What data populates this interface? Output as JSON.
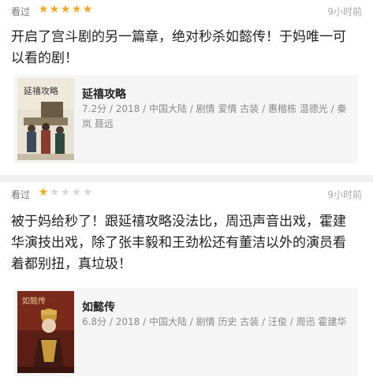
{
  "reviews": [
    {
      "status": "看过",
      "rating": 5,
      "time": "9小时前",
      "text": "开启了宫斗剧的另一篇章，绝对秒杀如懿传！于妈唯一可以看的剧！",
      "movie": {
        "title": "延禧攻略",
        "info": "7.2分 / 2018 / 中国大陆 / 剧情 爱情 古装 / 惠楷栋 温德光 / 秦岚 聂远",
        "poster_label": "延禧攻略"
      }
    },
    {
      "status": "看过",
      "rating": 1,
      "time": "9小时前",
      "text": "被于妈给秒了！跟延禧攻略没法比，周迅声音出戏，霍建华演技出戏，除了张丰毅和王劲松还有董洁以外的演员看着都别扭，真垃圾！",
      "movie": {
        "title": "如懿传",
        "info": "6.8分 / 2018 / 中国大陆 / 剧情 历史 古装 / 汪俊 / 周迅 霍建华",
        "poster_label": "如懿传"
      }
    }
  ],
  "colors": {
    "star_on": "#f6a623",
    "star_off": "#d9d9d9"
  }
}
